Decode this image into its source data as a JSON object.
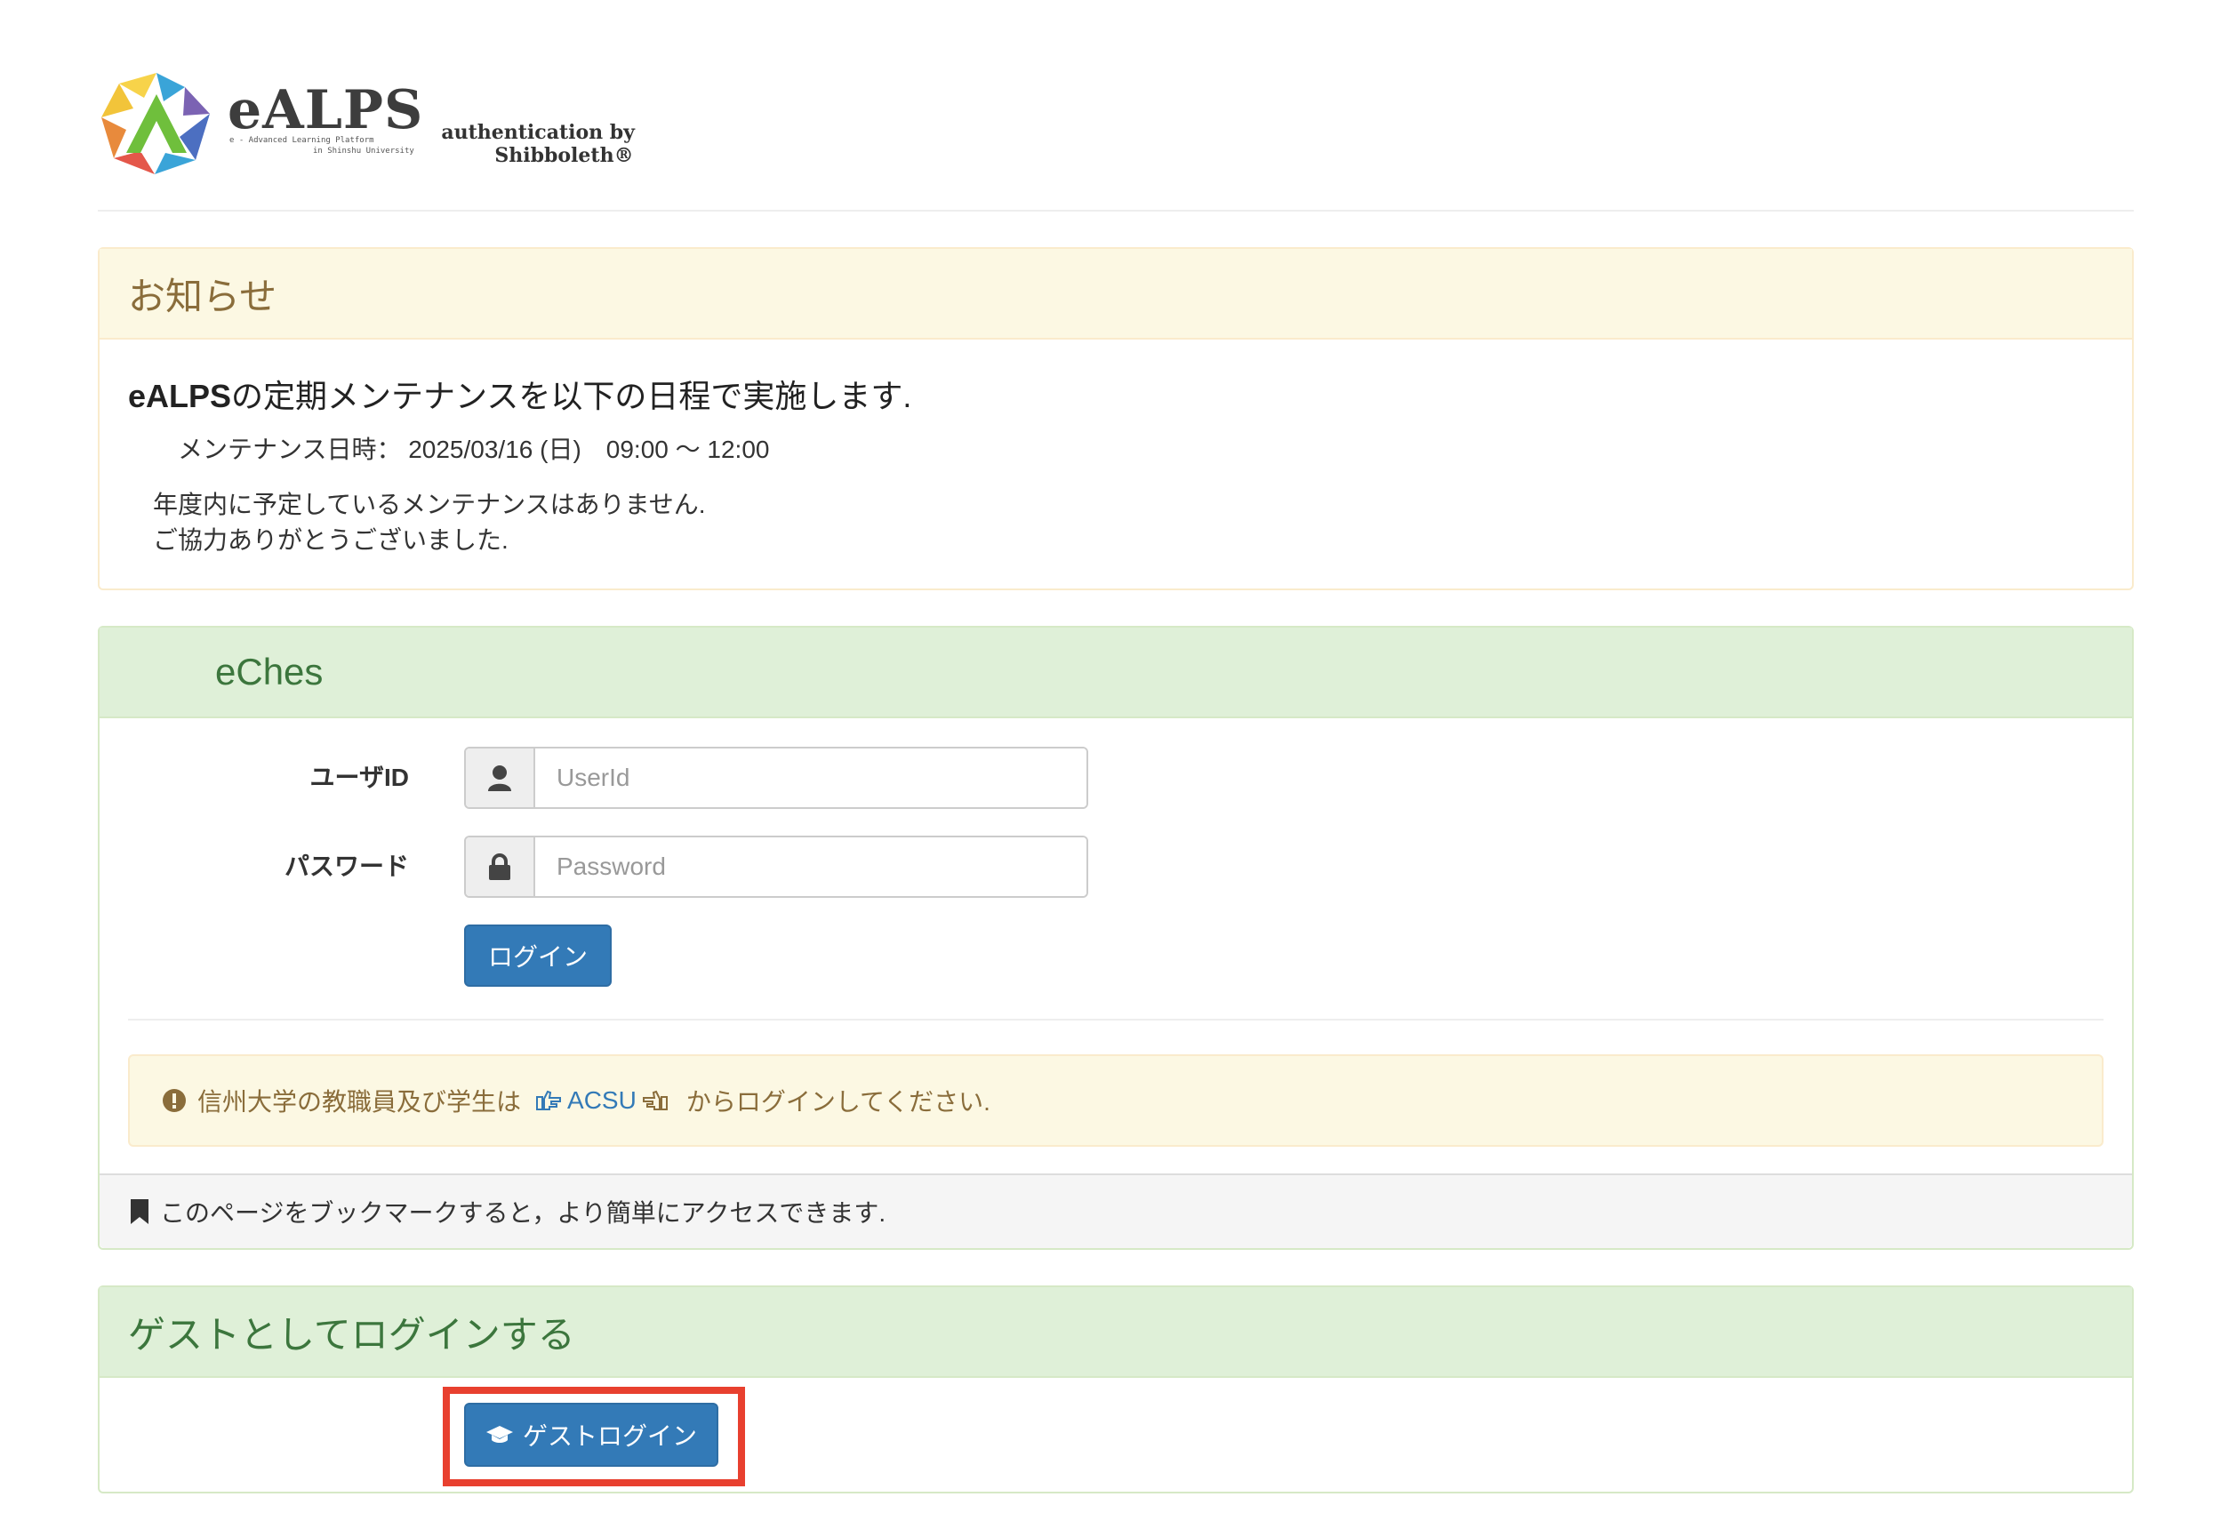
{
  "header": {
    "logo_word": "eALPS",
    "logo_sub_1": "e - Advanced Learning Platform",
    "logo_sub_2": "in Shinshu University",
    "auth_line_1": "authentication by",
    "auth_line_2": "Shibboleth®"
  },
  "notice": {
    "heading": "お知らせ",
    "title_bold": "eALPS",
    "title_rest": "の定期メンテナンスを以下の日程で実施します.",
    "date_line": "メンテナンス日時： 2025/03/16 (日)　09:00 〜 12:00",
    "line_1": "年度内に予定しているメンテナンスはありません.",
    "line_2": "ご協力ありがとうございました."
  },
  "login": {
    "heading": "eChes",
    "userid_label": "ユーザID",
    "userid_placeholder": "UserId",
    "password_label": "パスワード",
    "password_placeholder": "Password",
    "login_button": "ログイン",
    "alert_prefix": "信州大学の教職員及び学生は",
    "alert_link": "ACSU",
    "alert_suffix": "からログインしてください.",
    "footer_text": "このページをブックマークすると，より簡単にアクセスできます."
  },
  "guest": {
    "heading": "ゲストとしてログインする",
    "button": "ゲストログイン"
  },
  "colors": {
    "primary": "#337ab7",
    "warning_bg": "#fcf8e3",
    "warning_text": "#8a6d3b",
    "success_bg": "#dff0d8",
    "success_text": "#3c763d",
    "highlight": "#e8402f"
  },
  "icons": {
    "user": "user-icon",
    "lock": "lock-icon",
    "exclamation": "exclamation-circle-icon",
    "hand_right": "hand-point-right-icon",
    "hand_left": "hand-point-left-icon",
    "bookmark": "bookmark-icon",
    "graduation": "graduation-cap-icon"
  }
}
